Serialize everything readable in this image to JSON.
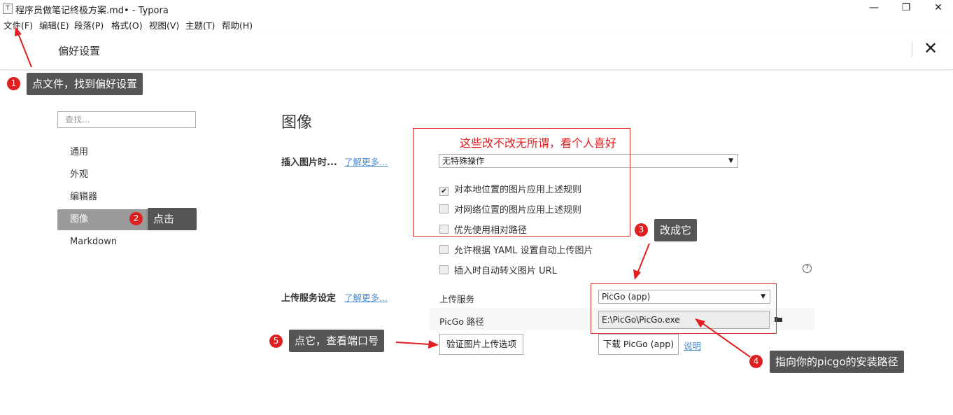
{
  "window": {
    "app_icon": "T",
    "title": "程序员做笔记终极方案.md• - Typora",
    "minimize": "—",
    "maximize": "❐",
    "close": "✕"
  },
  "menubar": {
    "items": [
      "文件(F)",
      "编辑(E)",
      "段落(P)",
      "格式(O)",
      "视图(V)",
      "主题(T)",
      "帮助(H)"
    ]
  },
  "preferences": {
    "title": "偏好设置",
    "close": "✕",
    "search_placeholder": "查找...",
    "nav": [
      {
        "label": "通用",
        "active": false
      },
      {
        "label": "外观",
        "active": false
      },
      {
        "label": "编辑器",
        "active": false
      },
      {
        "label": "图像",
        "active": true
      },
      {
        "label": "Markdown",
        "active": false
      }
    ]
  },
  "image_section": {
    "title": "图像",
    "insert": {
      "label": "插入图片时...",
      "learn_more": "了解更多...",
      "selected": "无特殊操作",
      "options": [
        {
          "label": "对本地位置的图片应用上述规则",
          "checked": true
        },
        {
          "label": "对网络位置的图片应用上述规则",
          "checked": false
        },
        {
          "label": "优先使用相对路径",
          "checked": false
        },
        {
          "label": "允许根据 YAML 设置自动上传图片",
          "checked": false
        },
        {
          "label": "插入时自动转义图片 URL",
          "checked": false
        }
      ]
    },
    "upload": {
      "label": "上传服务设定",
      "learn_more": "了解更多...",
      "service_label": "上传服务",
      "service_value": "PicGo (app)",
      "path_label": "PicGo 路径",
      "path_value": "E:\\PicGo\\PicGo.exe",
      "verify_button": "验证图片上传选项",
      "download_button": "下载 PicGo (app)",
      "explain_link": "说明"
    },
    "help_icon": "?"
  },
  "annotations": {
    "note_red": "这些改不改无所谓，看个人喜好",
    "callouts": [
      {
        "num": "1",
        "text": "点文件，找到偏好设置"
      },
      {
        "num": "2",
        "text": "点击"
      },
      {
        "num": "3",
        "text": "改成它"
      },
      {
        "num": "4",
        "text": "指向你的picgo的安装路径"
      },
      {
        "num": "5",
        "text": "点它，查看端口号"
      }
    ],
    "accent": "#e02020"
  }
}
